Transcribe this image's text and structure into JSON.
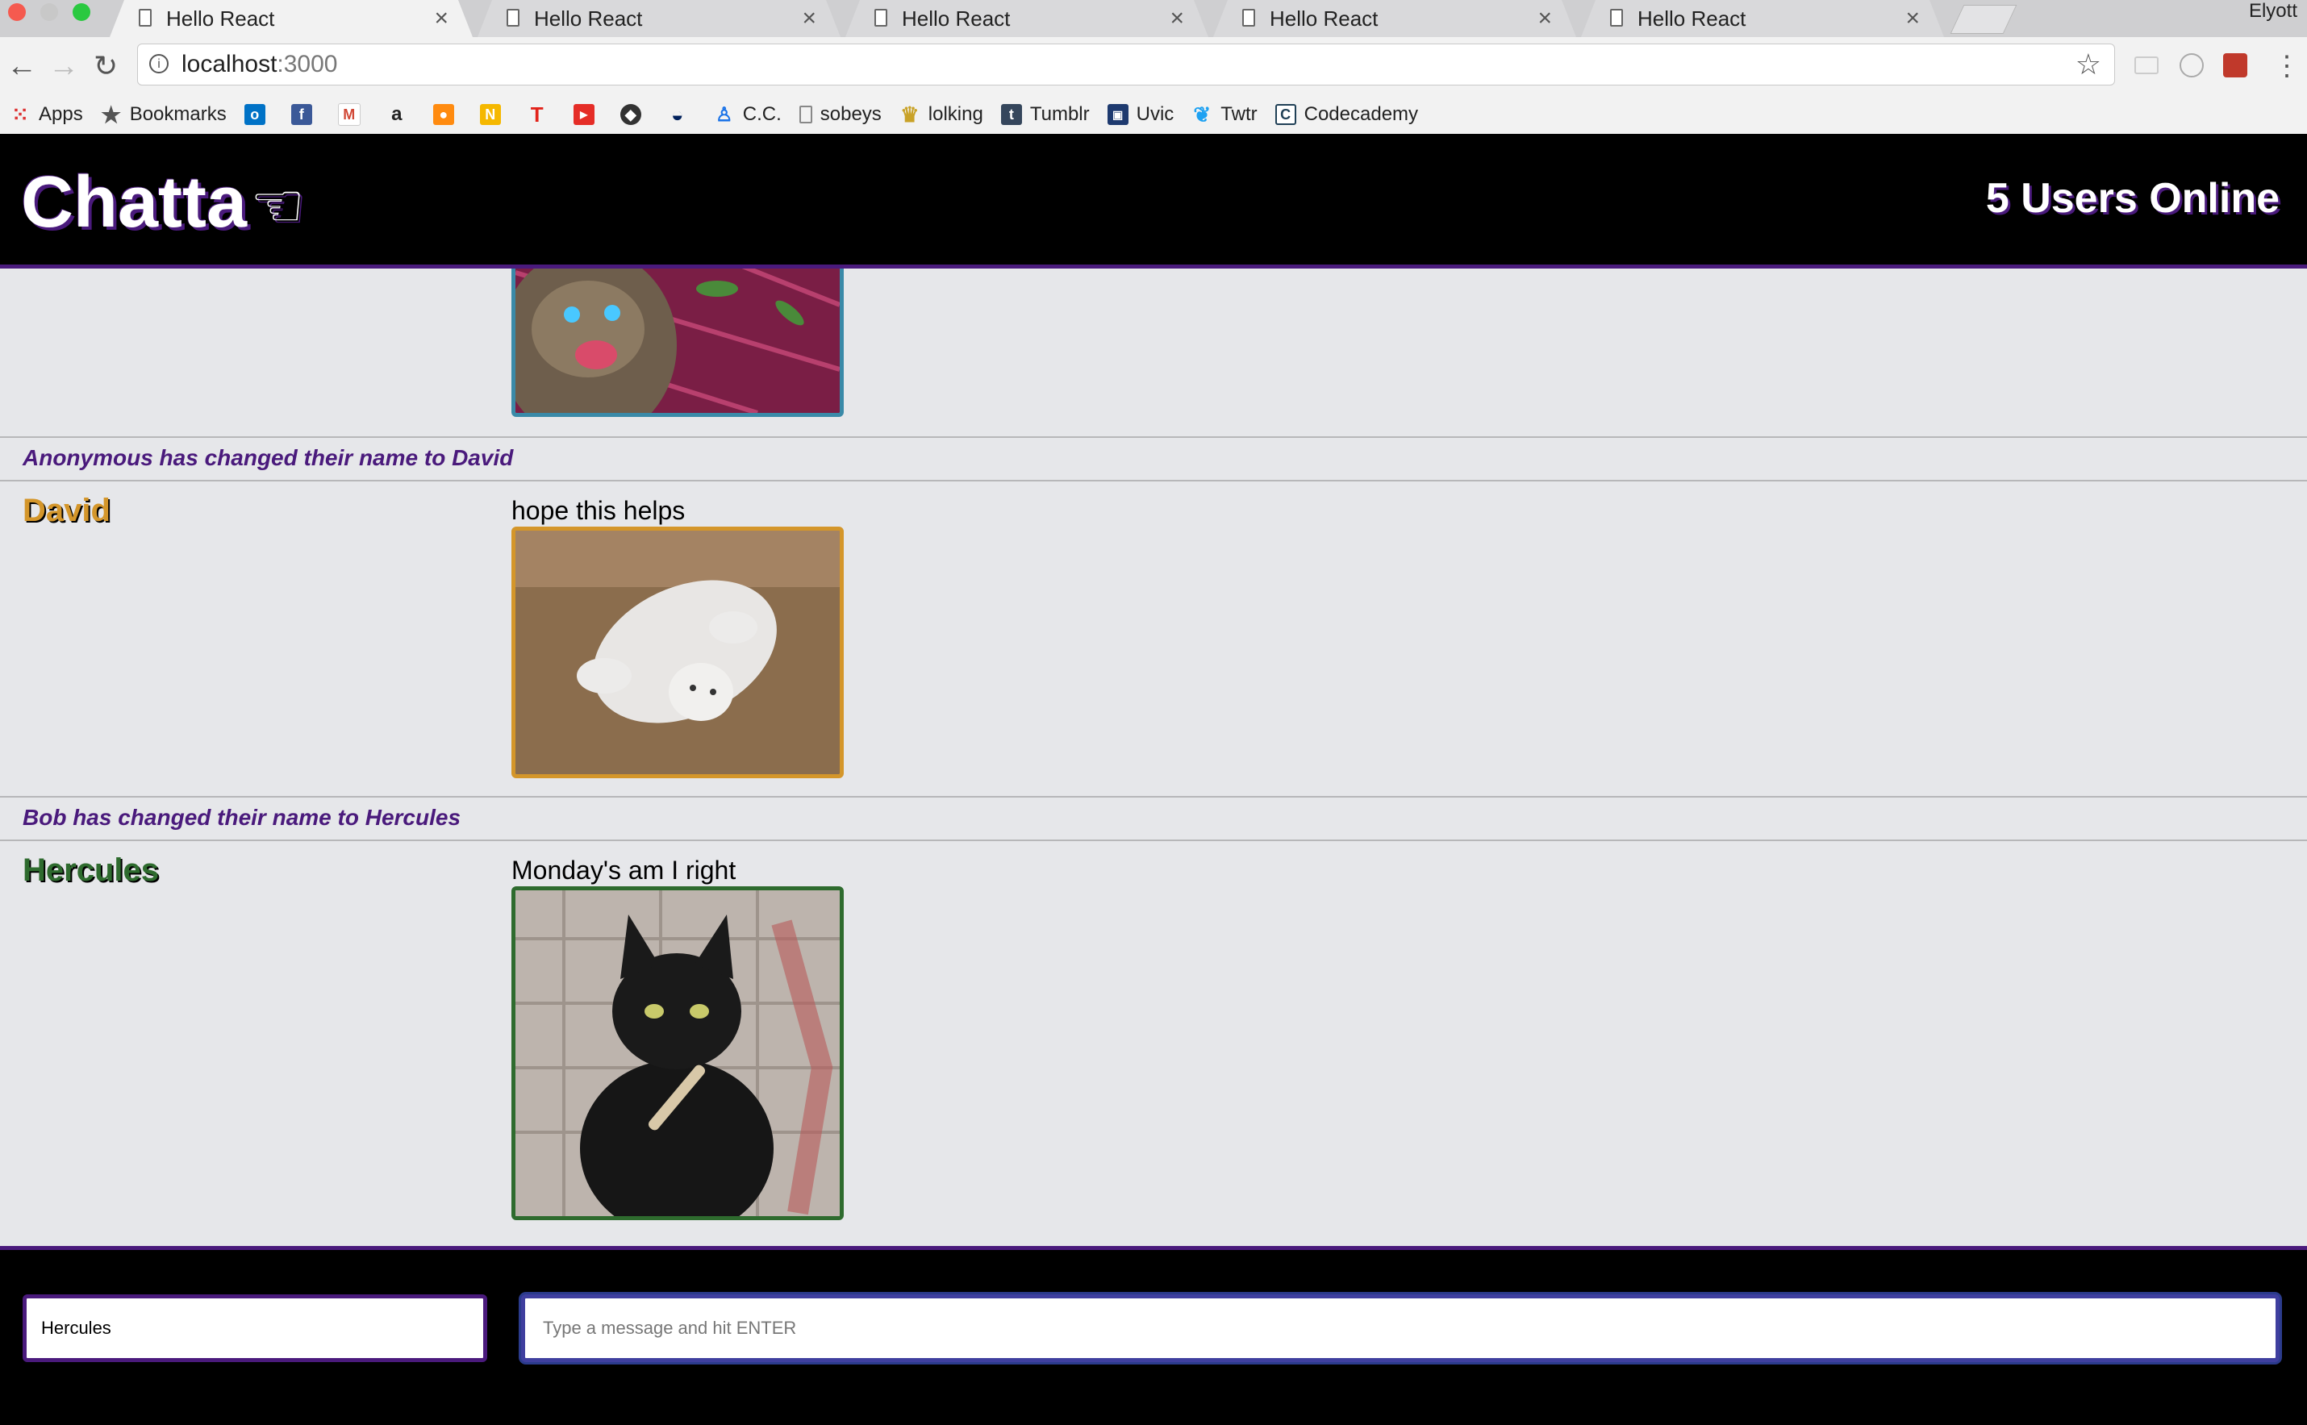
{
  "browser": {
    "tabs": [
      {
        "title": "Hello React",
        "active": true
      },
      {
        "title": "Hello React",
        "active": false
      },
      {
        "title": "Hello React",
        "active": false
      },
      {
        "title": "Hello React",
        "active": false
      },
      {
        "title": "Hello React",
        "active": false
      }
    ],
    "profile_name": "Elyott",
    "url_host": "localhost",
    "url_port": ":3000",
    "bookmarks": [
      {
        "label": "Apps",
        "icon": "apps-grid-icon",
        "color": "#d33"
      },
      {
        "label": "Bookmarks",
        "icon": "star-icon",
        "color": "#555"
      },
      {
        "label": "",
        "icon": "outlook-icon",
        "color": "#0072c6"
      },
      {
        "label": "",
        "icon": "facebook-icon",
        "color": "#3b5998"
      },
      {
        "label": "",
        "icon": "gmail-icon",
        "color": "#d14836"
      },
      {
        "label": "",
        "icon": "amazon-icon",
        "color": "#222"
      },
      {
        "label": "",
        "icon": "reddit-icon",
        "color": "#ff8b10"
      },
      {
        "label": "",
        "icon": "n-icon",
        "color": "#f5b800"
      },
      {
        "label": "",
        "icon": "t-icon",
        "color": "#e2231a"
      },
      {
        "label": "",
        "icon": "youtube-icon",
        "color": "#e52d27"
      },
      {
        "label": "",
        "icon": "nhl-icon",
        "color": "#333"
      },
      {
        "label": "",
        "icon": "canucks-icon",
        "color": "#00205b"
      },
      {
        "label": "C.C.",
        "icon": "person-icon",
        "color": "#1a73e8"
      },
      {
        "label": "sobeys",
        "icon": "page-icon",
        "color": "#888"
      },
      {
        "label": "lolking",
        "icon": "crown-icon",
        "color": "#c9a227"
      },
      {
        "label": "Tumblr",
        "icon": "tumblr-icon",
        "color": "#35465c"
      },
      {
        "label": "Uvic",
        "icon": "uvic-icon",
        "color": "#1e3a6f"
      },
      {
        "label": "Twtr",
        "icon": "twitter-icon",
        "color": "#1da1f2"
      },
      {
        "label": "Codecademy",
        "icon": "codecademy-icon",
        "color": "#204056"
      }
    ]
  },
  "app": {
    "logo": "Chatta",
    "users_online": "5 Users Online",
    "accent_color": "#4a1a7c"
  },
  "messages": [
    {
      "type": "message",
      "user": "",
      "text": "",
      "image": "cat-screaming-gif",
      "border_color": "#3a8aa8"
    },
    {
      "type": "notification",
      "text": "Anonymous has changed their name to David"
    },
    {
      "type": "message",
      "user": "David",
      "text": "hope this helps",
      "image": "white-cat-rolling-gif",
      "user_color": "#d4962a",
      "border_color": "#d4962a"
    },
    {
      "type": "notification",
      "text": "Bob has changed their name to Hercules"
    },
    {
      "type": "message",
      "user": "Hercules",
      "text": "Monday's am I right",
      "image": "black-cat-nail-file-gif",
      "user_color": "#2e6b2e",
      "border_color": "#2e6b2e"
    }
  ],
  "chat_bar": {
    "username_value": "Hercules",
    "message_placeholder": "Type a message and hit ENTER"
  }
}
